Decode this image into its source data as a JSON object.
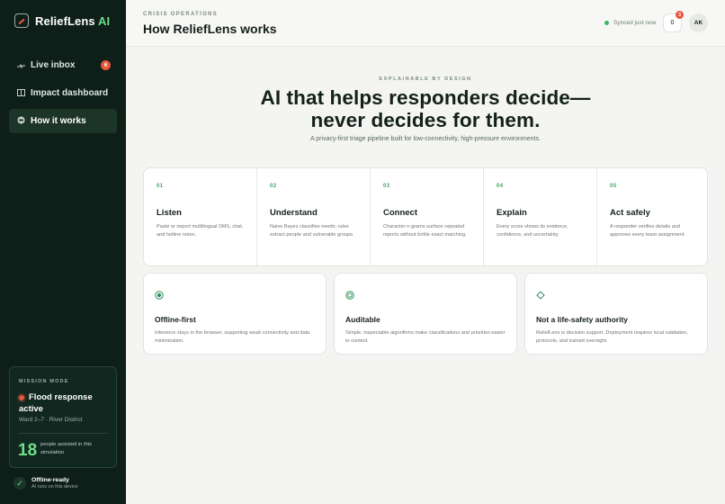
{
  "brand": {
    "name": "ReliefLens",
    "suffix": "AI"
  },
  "nav": [
    {
      "icon": "pulse-icon",
      "label": "Live inbox",
      "badge": "6"
    },
    {
      "icon": "grid-icon",
      "label": "Impact dashboard"
    },
    {
      "icon": "info-icon",
      "label": "How it works",
      "active": true
    }
  ],
  "mission": {
    "label": "MISSION MODE",
    "title": "Flood response active",
    "ward": "Ward 2–7 · River District",
    "count": "18",
    "count_label": "people assisted in this simulation"
  },
  "offline": {
    "title": "Offline-ready",
    "subtitle": "AI runs on this device"
  },
  "header": {
    "kicker": "CRISIS OPERATIONS",
    "title": "How ReliefLens works",
    "sync": "Synced just now",
    "notifications_value": "0",
    "notifications_badge": "3",
    "avatar": "AK"
  },
  "hero": {
    "kicker": "EXPLAINABLE BY DESIGN",
    "title_line1": "AI that helps responders decide—",
    "title_line2": "never decides for them.",
    "subtitle": "A privacy-first triage pipeline built for low-connectivity, high-pressure environments."
  },
  "steps": [
    {
      "num": "01",
      "title": "Listen",
      "desc": "Paste or import multilingual SMS, chat, and hotline notes."
    },
    {
      "num": "02",
      "title": "Understand",
      "desc": "Naive Bayes classifies needs; rules extract people and vulnerable groups."
    },
    {
      "num": "03",
      "title": "Connect",
      "desc": "Character n-grams surface repeated reports without brittle exact matching."
    },
    {
      "num": "04",
      "title": "Explain",
      "desc": "Every score shows its evidence, confidence, and uncertainty."
    },
    {
      "num": "05",
      "title": "Act safely",
      "desc": "A responder verifies details and approves every team assignment."
    }
  ],
  "principles": [
    {
      "icon": "radio-target-icon",
      "title": "Offline-first",
      "desc": "Inference stays in the browser, supporting weak connectivity and data minimization."
    },
    {
      "icon": "target-icon",
      "title": "Auditable",
      "desc": "Simple, inspectable algorithms make classifications and priorities easier to contest."
    },
    {
      "icon": "diamond-icon",
      "title": "Not a life-safety authority",
      "desc": "ReliefLens is decision support. Deployment requires local validation, protocols, and trained oversight."
    }
  ],
  "colors": {
    "sidebar": "#0d1f18",
    "accent": "#6ddf8a",
    "alert": "#e8553b",
    "step_number": "#3fa463"
  }
}
